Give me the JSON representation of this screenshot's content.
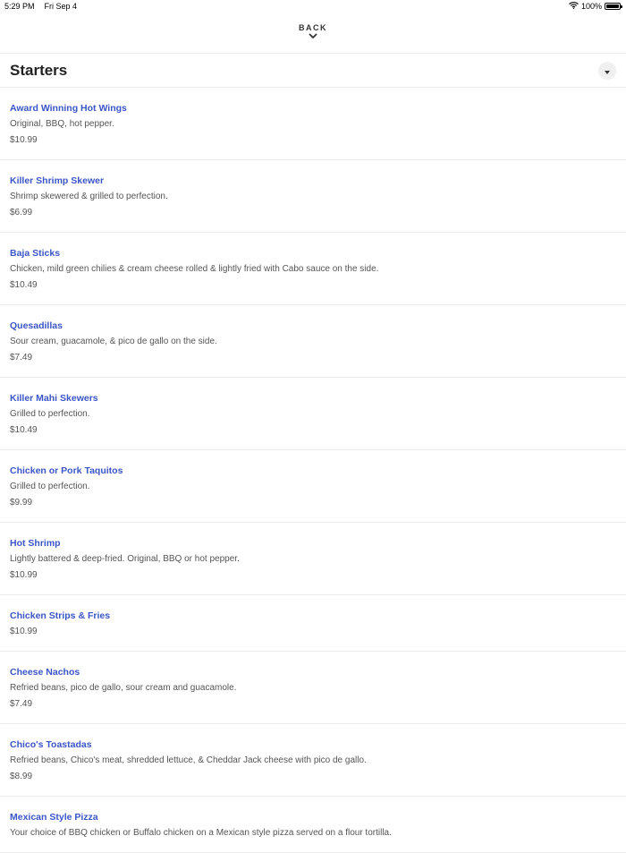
{
  "status_bar": {
    "time": "5:29 PM",
    "date": "Fri Sep 4",
    "battery": "100%",
    "battery_level": 1.0
  },
  "nav": {
    "back_label": "BACK"
  },
  "section": {
    "title": "Starters"
  },
  "items": [
    {
      "name": "Award Winning Hot Wings",
      "description": "Original, BBQ, hot pepper.",
      "price": "$10.99"
    },
    {
      "name": "Killer Shrimp Skewer",
      "description": "Shrimp skewered & grilled to perfection.",
      "price": "$6.99"
    },
    {
      "name": "Baja Sticks",
      "description": "Chicken, mild green chilies & cream cheese rolled & lightly fried with Cabo sauce on the side.",
      "price": "$10.49"
    },
    {
      "name": "Quesadillas",
      "description": "Sour cream, guacamole, & pico de gallo on the side.",
      "price": "$7.49"
    },
    {
      "name": "Killer Mahi Skewers",
      "description": "Grilled to perfection.",
      "price": "$10.49"
    },
    {
      "name": "Chicken or Pork Taquitos",
      "description": "Grilled to perfection.",
      "price": "$9.99"
    },
    {
      "name": "Hot Shrimp",
      "description": "Lightly battered & deep-fried. Original, BBQ or hot pepper.",
      "price": "$10.99"
    },
    {
      "name": "Chicken Strips & Fries",
      "description": "",
      "price": "$10.99"
    },
    {
      "name": "Cheese Nachos",
      "description": "Refried beans, pico de gallo, sour cream and guacamole.",
      "price": "$7.49"
    },
    {
      "name": "Chico's Toastadas",
      "description": "Refried beans, Chico's meat, shredded lettuce, & Cheddar Jack cheese with pico de gallo.",
      "price": "$8.99"
    },
    {
      "name": "Mexican Style Pizza",
      "description": "Your choice of BBQ chicken or Buffalo chicken on a Mexican style pizza served on a flour tortilla.",
      "price": ""
    }
  ]
}
